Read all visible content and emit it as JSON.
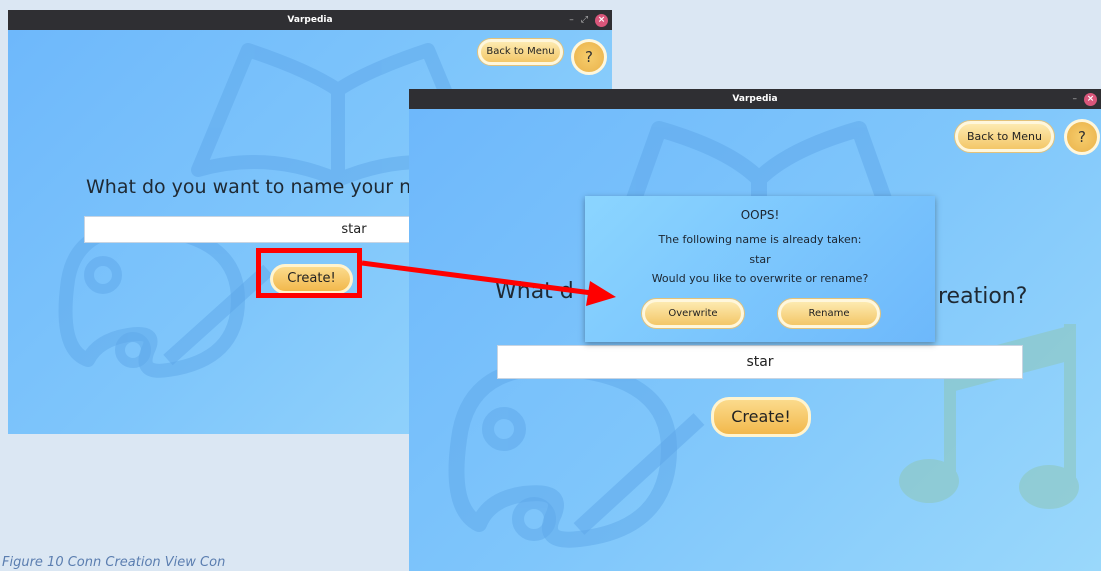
{
  "colors": {
    "accent": "#f2b84c",
    "highlight": "#ff0000",
    "titlebar": "#2f2f33"
  },
  "window_back": {
    "title": "Varpedia",
    "back_label": "Back to Menu",
    "help_label": "?",
    "question": "What do you want to name your n",
    "name_value": "star",
    "create_label": "Create!"
  },
  "window_front": {
    "title": "Varpedia",
    "back_label": "Back to Menu",
    "help_label": "?",
    "question_left": "What d",
    "question_right": "reation?",
    "name_value": "star",
    "create_label": "Create!"
  },
  "dialog": {
    "title": "OOPS!",
    "line1": "The following name is already taken:",
    "name": "star",
    "line3": "Would you like to overwrite or rename?",
    "overwrite_label": "Overwrite",
    "rename_label": "Rename"
  },
  "caption": "Figure 10 Conn Creation View Con"
}
